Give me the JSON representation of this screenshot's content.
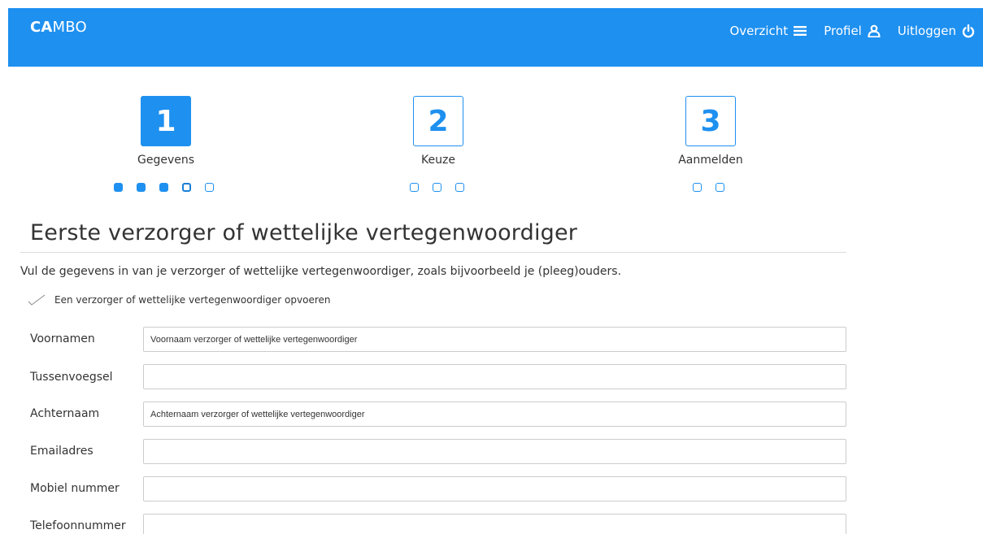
{
  "header": {
    "brand_bold": "CA",
    "brand_light": "MBO",
    "nav": [
      {
        "label": "Overzicht",
        "icon": "menu-icon"
      },
      {
        "label": "Profiel",
        "icon": "user-icon"
      },
      {
        "label": "Uitloggen",
        "icon": "power-icon"
      }
    ]
  },
  "colors": {
    "accent": "#1e90f0",
    "header_bg": "#1e90f0",
    "text": "#333333"
  },
  "steps": [
    {
      "number": "1",
      "label": "Gegevens",
      "active": true,
      "dots": [
        "filled",
        "filled",
        "filled",
        "current",
        "empty"
      ]
    },
    {
      "number": "2",
      "label": "Keuze",
      "active": false,
      "dots": [
        "empty",
        "empty",
        "empty"
      ]
    },
    {
      "number": "3",
      "label": "Aanmelden",
      "active": false,
      "dots": [
        "empty",
        "empty"
      ]
    }
  ],
  "section": {
    "title": "Eerste verzorger of wettelijke vertegenwoordiger",
    "intro": "Vul de gegevens in van je verzorger of wettelijke vertegenwoordiger, zoals bijvoorbeeld je (pleeg)ouders.",
    "add_label": "Een verzorger of wettelijke vertegenwoordiger opvoeren"
  },
  "form": {
    "fields": [
      {
        "label": "Voornamen",
        "value": "Voornaam verzorger of wettelijke vertegenwoordiger"
      },
      {
        "label": "Tussenvoegsel",
        "value": ""
      },
      {
        "label": "Achternaam",
        "value": "Achternaam verzorger of wettelijke vertegenwoordiger"
      },
      {
        "label": "Emailadres",
        "value": ""
      },
      {
        "label": "Mobiel nummer",
        "value": ""
      },
      {
        "label": "Telefoonnummer",
        "value": ""
      }
    ]
  }
}
